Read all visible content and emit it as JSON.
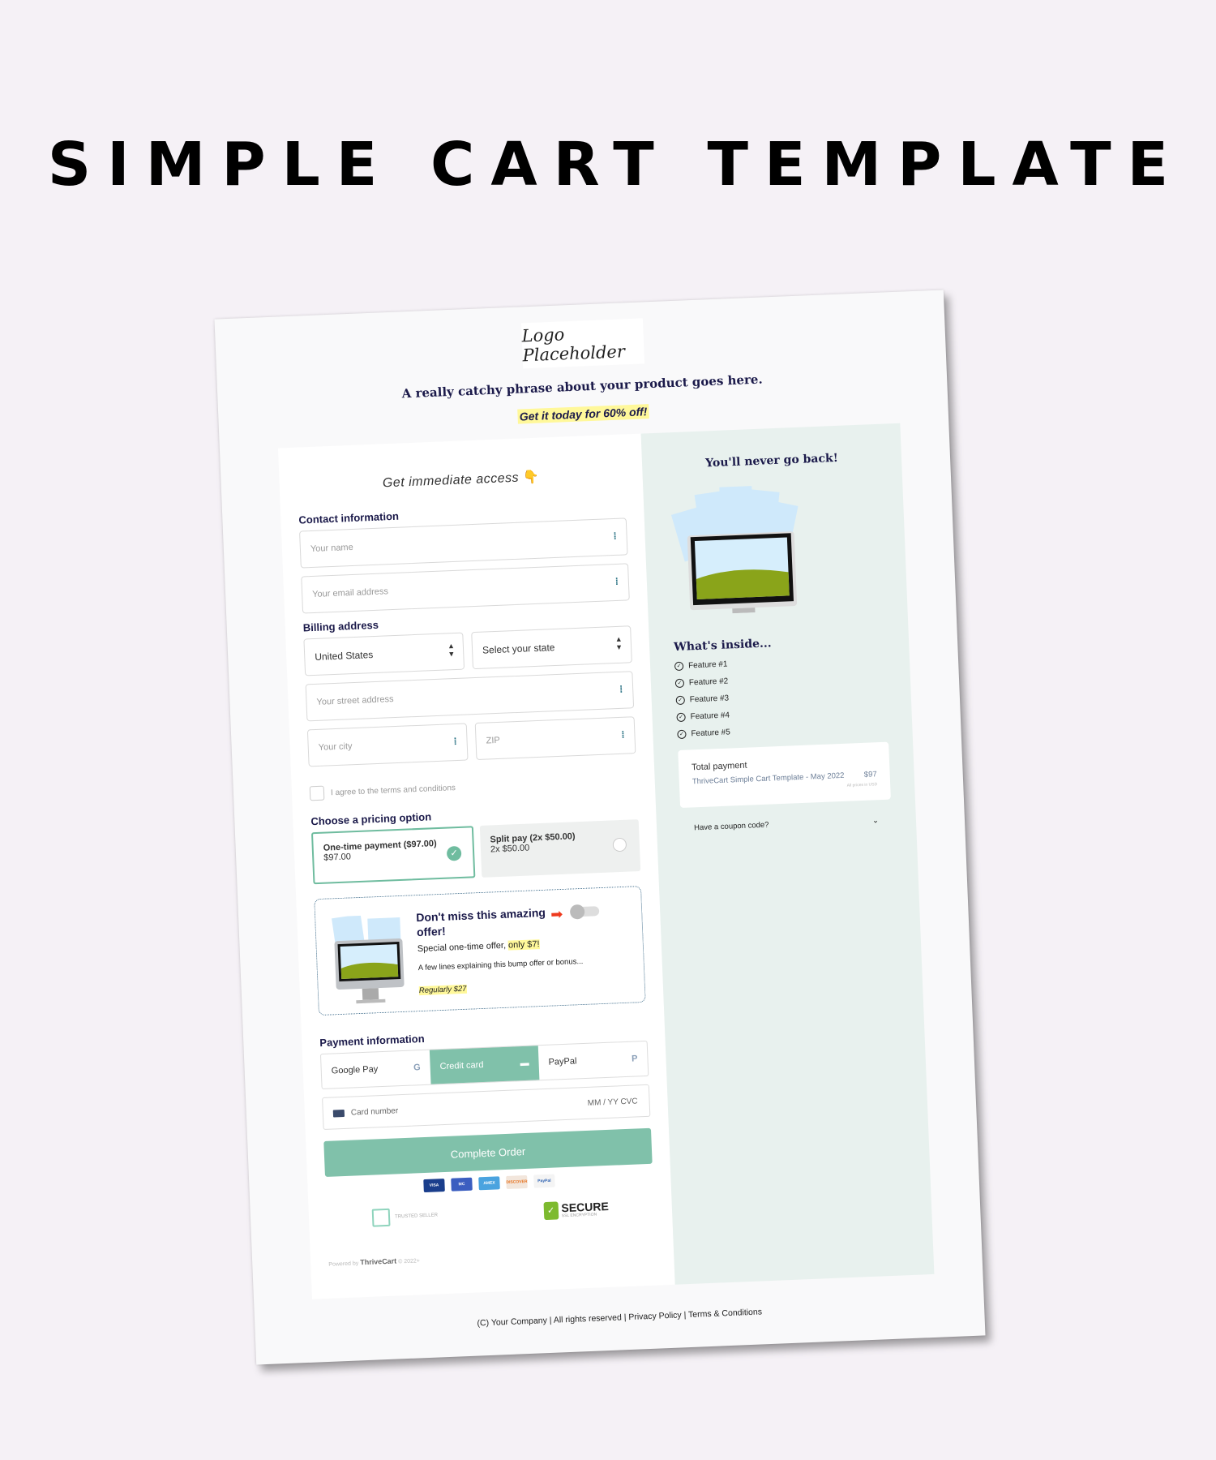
{
  "hero": {
    "title": "SIMPLE CART TEMPLATE"
  },
  "header": {
    "logo": "Logo Placeholder",
    "tagline": "A really catchy phrase about your product goes here.",
    "promo": "Get it today for 60% off!"
  },
  "form": {
    "access": "Get immediate access",
    "access_emoji": "👇",
    "contact_title": "Contact information",
    "name_placeholder": "Your name",
    "email_placeholder": "Your email address",
    "billing_title": "Billing address",
    "country": "United States",
    "state": "Select your state",
    "street_placeholder": "Your street address",
    "city_placeholder": "Your city",
    "zip_placeholder": "ZIP",
    "agree_text": "I agree to the  terms and conditions",
    "pricing_title": "Choose a pricing option",
    "pricing_options": [
      {
        "name": "One-time payment ($97.00)",
        "price": "$97.00",
        "selected": true
      },
      {
        "name": "Split pay (2x $50.00)",
        "price": "2x $50.00",
        "selected": false
      }
    ],
    "bump": {
      "title": "Don't miss this amazing offer!",
      "special_prefix": "Special one-time offer, ",
      "special_highlight": "only $7!",
      "description": "A few lines explaining this bump offer or bonus...",
      "regular": "Regularly $27",
      "toggle_on": false
    },
    "payment_title": "Payment information",
    "payment_tabs": [
      {
        "label": "Google Pay",
        "icon": "G",
        "active": false
      },
      {
        "label": "Credit card",
        "icon": "▬",
        "active": true
      },
      {
        "label": "PayPal",
        "icon": "P",
        "active": false
      }
    ],
    "card_placeholder": "Card number",
    "expiry_cvc": "MM / YY   CVC",
    "submit": "Complete Order",
    "card_brands": [
      "VISA",
      "MC",
      "AMEX",
      "DISCOVER",
      "PayPal"
    ],
    "trusted": "TRUSTED SELLER",
    "secure_title": "SECURE",
    "secure_sub": "SSL ENCRYPTION",
    "powered_prefix": "Powered by",
    "powered_brand": "ThriveCart",
    "powered_year": "© 2022+"
  },
  "sidebar": {
    "title": "You'll never go back!",
    "inside_title": "What's inside...",
    "features": [
      "Feature #1",
      "Feature #2",
      "Feature #3",
      "Feature #4",
      "Feature #5"
    ],
    "total_title": "Total payment",
    "product": "ThriveCart Simple Cart Template - May 2022",
    "price": "$97",
    "currency_note": "All prices in USD",
    "coupon": "Have a coupon code?"
  },
  "footer": {
    "text": "(C) Your Company | All rights reserved | Privacy Policy | Terms & Conditions"
  },
  "colors": {
    "accent": "#80c1aa",
    "navy": "#1b1a4a",
    "highlight": "#fff89a",
    "sidebar_bg": "#e8f1ee"
  }
}
